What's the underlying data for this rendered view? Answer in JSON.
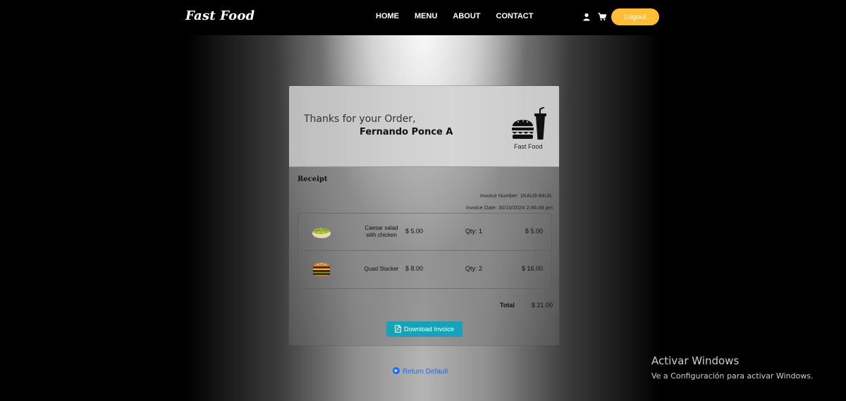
{
  "navbar": {
    "brand": "Fast Food",
    "links": [
      "HOME",
      "MENU",
      "ABOUT",
      "CONTACT"
    ],
    "icons": [
      "user-icon",
      "cart-icon"
    ],
    "logout_label": "Logout"
  },
  "order": {
    "thanks": "Thanks for your Order,",
    "customer": "Fernando Ponce A",
    "logo_label": "Fast Food",
    "receipt_title": "Receipt",
    "invoice_number": "Invoice Number: 1KAU9-84UIL",
    "invoice_date": "Invoice Date: 30/10/2024 2:46:48 pm",
    "items": [
      {
        "name_line1": "Caesar salad",
        "name_line2": "with chicken",
        "price": "$ 5.00",
        "qty": "Qty: 1",
        "subtotal": "$ 5.00",
        "image": "salad-image"
      },
      {
        "name_line1": "Quad Stacker",
        "name_line2": "",
        "price": "$ 8.00",
        "qty": "Qty: 2",
        "subtotal": "$ 16.00",
        "image": "burger-image"
      }
    ],
    "total_label": "Total",
    "total_value": "$ 21.00",
    "download_label": "Download Invoice"
  },
  "return_label": "Return Default",
  "windows_notice": {
    "title": "Activar Windows",
    "subtitle": "Ve a Configuración para activar Windows."
  },
  "colors": {
    "accent": "#ffbe33",
    "download_button": "#17a2b8",
    "link": "#1d6bf0"
  }
}
